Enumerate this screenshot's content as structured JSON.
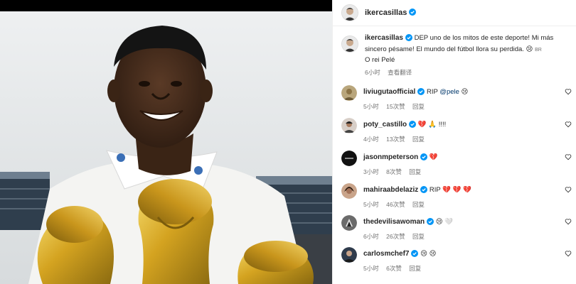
{
  "colors": {
    "accent": "#0095f6",
    "secondary_text": "#737373",
    "link": "#00376b"
  },
  "header": {
    "username": "ikercasillas",
    "verified": true
  },
  "caption": {
    "username": "ikercasillas",
    "text": "DEP uno de los mitos de este deporte! Mi más sincero pésame! El mundo del fútbol llora su perdida. 😢",
    "tag": "BR",
    "line2": "O rei Pelé",
    "time": "6小时",
    "translate_label": "查看翻译"
  },
  "comments": [
    {
      "username": "liviugutaofficial",
      "verified": true,
      "text": "RIP ",
      "mention": "@pele",
      "emoji": " 😢",
      "time": "5小时",
      "likes": "15次赞",
      "reply": "回复"
    },
    {
      "username": "poty_castillo",
      "verified": true,
      "text": "💔 🙏 !!!!",
      "time": "4小时",
      "likes": "13次赞",
      "reply": "回复"
    },
    {
      "username": "jasonmpeterson",
      "verified": true,
      "text": "💔",
      "time": "3小时",
      "likes": "8次赞",
      "reply": "回复"
    },
    {
      "username": "mahiraabdelaziz",
      "verified": true,
      "text": "RIP 💔 💔 💔",
      "time": "5小时",
      "likes": "46次赞",
      "reply": "回复"
    },
    {
      "username": "thedevilisawoman",
      "verified": true,
      "text": "😢 🤍",
      "time": "6小时",
      "likes": "26次赞",
      "reply": "回复"
    },
    {
      "username": "carlosmchef7",
      "verified": true,
      "text": "😢 😢",
      "time": "5小时",
      "likes": "6次赞",
      "reply": "回复"
    }
  ]
}
